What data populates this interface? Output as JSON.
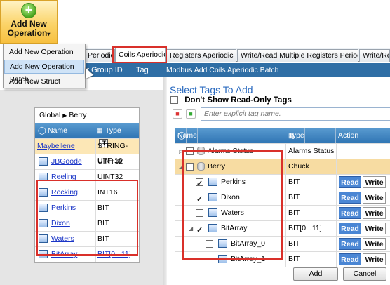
{
  "add_op_button": {
    "line1": "Add New",
    "line2": "Operation",
    "plus": "+",
    "arrow": "▾"
  },
  "menu": {
    "items": [
      "Add New Operation",
      "Add New Operation Batch",
      "Add New Struct"
    ],
    "highlighted": 1
  },
  "tabs": [
    "Periodic",
    "Coils Aperiodic",
    "Registers Aperiodic",
    "Write/Read Multiple Registers Periodic",
    "Write/Re"
  ],
  "active_tab": "Coils Aperiodic",
  "left_columns": [
    "t Group ID",
    "Tag"
  ],
  "panel_title": "Modbus Add Coils Aperiodic Batch",
  "left_grid": {
    "breadcrumb": {
      "root": "Global",
      "sep": "▶",
      "leaf": "Berry"
    },
    "headers": {
      "name": "Name",
      "type": "Type"
    },
    "rows": [
      {
        "name": "Maybellene",
        "type": "STRING-UTF-16",
        "icon": "T",
        "selected": true
      },
      {
        "name": "JBGoode",
        "type": "UINT32",
        "icon": "grid"
      },
      {
        "name": "Reeling",
        "type": "UINT32",
        "icon": "grid"
      },
      {
        "name": "Rocking",
        "type": "INT16",
        "icon": "grid"
      },
      {
        "name": "Perkins",
        "type": "BIT",
        "icon": "bit"
      },
      {
        "name": "Dixon",
        "type": "BIT",
        "icon": "bit"
      },
      {
        "name": "Waters",
        "type": "BIT",
        "icon": "bit"
      },
      {
        "name": "BitArray",
        "type": "BIT[0...11]",
        "icon": "bit",
        "type_link": true
      }
    ]
  },
  "select_tags": {
    "title": "Select Tags To Add",
    "dont_show": "Don't Show Read-Only Tags",
    "placeholder": "Enter explicit tag name."
  },
  "right_grid": {
    "headers": {
      "name": "Name",
      "type": "Type",
      "action": "Action"
    },
    "rows": [
      {
        "name": "Alarms Status",
        "type": "Alarms Status",
        "indent": 0,
        "expander": "▷",
        "checkbox": false,
        "icon": "db",
        "actions": false
      },
      {
        "name": "Berry",
        "type": "Chuck",
        "indent": 0,
        "expander": "◢",
        "checkbox": false,
        "icon": "db",
        "actions": false,
        "group": true
      },
      {
        "name": "Perkins",
        "type": "BIT",
        "indent": 1,
        "checkbox": true,
        "icon": "bit",
        "actions": true
      },
      {
        "name": "Dixon",
        "type": "BIT",
        "indent": 1,
        "checkbox": true,
        "icon": "bit",
        "actions": true
      },
      {
        "name": "Waters",
        "type": "BIT",
        "indent": 1,
        "checkbox": false,
        "icon": "bit",
        "actions": true
      },
      {
        "name": "BitArray",
        "type": "BIT[0...11]",
        "indent": 1,
        "expander": "◢",
        "checkbox": true,
        "icon": "bit",
        "actions": true
      },
      {
        "name": "BitArray_0",
        "type": "BIT",
        "indent": 2,
        "checkbox": false,
        "icon": "bit",
        "actions": true
      },
      {
        "name": "BitArray_1",
        "type": "BIT",
        "indent": 2,
        "checkbox": false,
        "icon": "bit",
        "actions": true
      }
    ],
    "read_label": "Read",
    "write_label": "Write"
  },
  "buttons": {
    "add": "Add",
    "cancel": "Cancel"
  },
  "colors": {
    "highlight_red": "#d9302a",
    "header_blue": "#2f6ea5",
    "read_blue": "#4a86d4",
    "group_row": "#f7dca2"
  }
}
